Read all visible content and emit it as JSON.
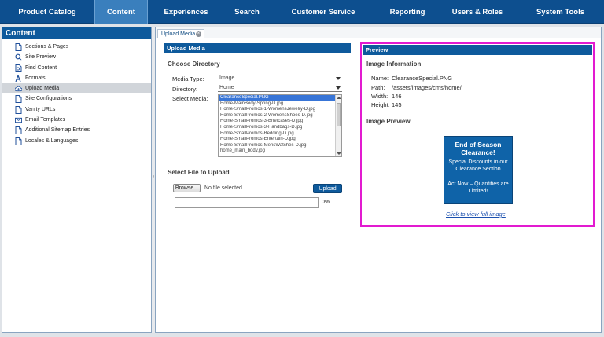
{
  "topnav": {
    "items": [
      {
        "label": "Product Catalog"
      },
      {
        "label": "Content"
      },
      {
        "label": "Experiences"
      },
      {
        "label": "Search"
      },
      {
        "label": "Customer Service"
      },
      {
        "label": "Reporting"
      },
      {
        "label": "Users & Roles"
      },
      {
        "label": "System Tools"
      }
    ],
    "active": "Content"
  },
  "sidebar": {
    "title": "Content",
    "items": [
      {
        "label": "Sections & Pages",
        "icon": "page-icon"
      },
      {
        "label": "Site Preview",
        "icon": "magnifier-icon"
      },
      {
        "label": "Find Content",
        "icon": "find-page-icon"
      },
      {
        "label": "Formats",
        "icon": "format-icon"
      },
      {
        "label": "Upload Media",
        "icon": "cloud-upload-icon",
        "active": true
      },
      {
        "label": "Site Configurations",
        "icon": "page-icon"
      },
      {
        "label": "Vanity URLs",
        "icon": "page-icon"
      },
      {
        "label": "Email Templates",
        "icon": "email-icon"
      },
      {
        "label": "Additional Sitemap Entries",
        "icon": "page-icon"
      },
      {
        "label": "Locales & Languages",
        "icon": "page-icon"
      }
    ]
  },
  "tab": {
    "label": "Upload Media"
  },
  "upload": {
    "header": "Upload Media",
    "choose_directory_title": "Choose Directory",
    "media_type_label": "Media Type:",
    "media_type_value": "Image",
    "directory_label": "Directory:",
    "directory_value": "Home",
    "select_media_label": "Select Media:",
    "media_options": [
      "ClearanceSpecial.PNG",
      "Home-MainBody-Spring-D.jpg",
      "Home-SmallPromos-1-WomensJewelry-D.jpg",
      "Home-SmallPromos-2-WomensShoes-D.jpg",
      "Home-SmallPromos-3-Briefcases-D.jpg",
      "Home-SmallPromos-3-Handbags-D.jpg",
      "Home-SmallPromos-Bedding-D.jpg",
      "Home-SmallPromos-Entertain-D.jpg",
      "Home-SmallPromos-MensWatches-D.jpg",
      "home_main_body.jpg"
    ],
    "selected_media": "ClearanceSpecial.PNG",
    "select_file_title": "Select File to Upload",
    "browse_label": "Browse...",
    "no_file_text": "No file selected.",
    "upload_label": "Upload",
    "progress_percent": 0,
    "progress_text": "0%"
  },
  "preview": {
    "header": "Preview",
    "info_title": "Image Information",
    "name_label": "Name:",
    "name_value": "ClearanceSpecial.PNG",
    "path_label": "Path:",
    "path_value": "/assets/images/cms/home/",
    "width_label": "Width:",
    "width_value": "146",
    "height_label": "Height:",
    "height_value": "145",
    "image_preview_title": "Image Preview",
    "promo": {
      "heading": "End of Season Clearance!",
      "body": "Special Discounts in our Clearance Section",
      "cta": "Act Now – Quantities are Limited!"
    },
    "view_full_link": "Click to view full image"
  },
  "colors": {
    "nav_bg": "#0d4f8f",
    "nav_active": "#3a7fbd",
    "panel_header": "#0e5a9c",
    "highlight_border": "#e21ad0",
    "selected_option": "#3875d7"
  }
}
